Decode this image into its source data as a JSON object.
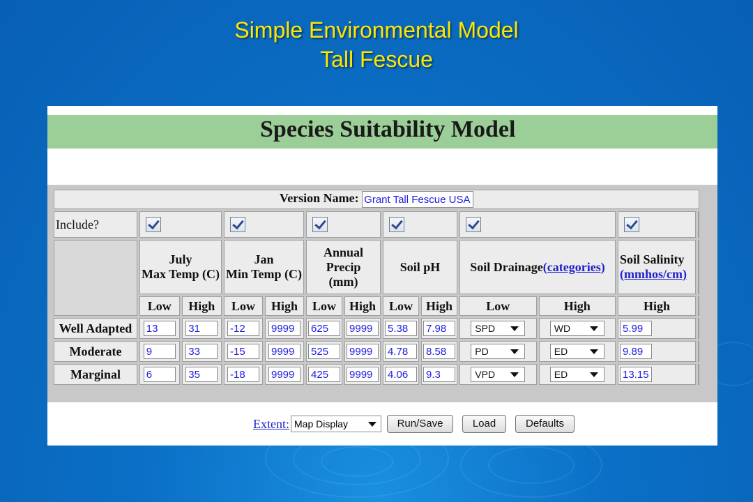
{
  "slide": {
    "title_line1": "Simple Environmental Model",
    "title_line2": "Tall Fescue"
  },
  "app": {
    "banner_title": "Species Suitability Model",
    "version_label": "Version Name:",
    "version_value": "Grant Tall Fescue USA",
    "include_label": "Include?",
    "columns": {
      "july_max": [
        "July",
        "Max Temp (C)"
      ],
      "jan_min": [
        "Jan",
        "Min Temp (C)"
      ],
      "precip": [
        "Annual",
        "Precip",
        "(mm)"
      ],
      "soil_ph": "Soil pH",
      "drainage": "Soil Drainage",
      "drainage_link": "(categories)",
      "salinity": "Soil Salinity",
      "salinity_link": "(mmhos/cm)"
    },
    "subheaders": {
      "low": "Low",
      "high": "High"
    },
    "rows": [
      {
        "label": "Well Adapted",
        "values": [
          "13",
          "31",
          "-12",
          "9999",
          "625",
          "9999",
          "5.38",
          "7.98"
        ],
        "drain_low": "SPD",
        "drain_high": "WD",
        "salinity": "5.99"
      },
      {
        "label": "Moderate",
        "values": [
          "9",
          "33",
          "-15",
          "9999",
          "525",
          "9999",
          "4.78",
          "8.58"
        ],
        "drain_low": "PD",
        "drain_high": "ED",
        "salinity": "9.89"
      },
      {
        "label": "Marginal",
        "values": [
          "6",
          "35",
          "-18",
          "9999",
          "425",
          "9999",
          "4.06",
          "9.3"
        ],
        "drain_low": "VPD",
        "drain_high": "ED",
        "salinity": "13.15"
      }
    ],
    "bottom": {
      "extent_label": "Extent:",
      "extent_value": "Map Display",
      "run_save": "Run/Save",
      "load": "Load",
      "defaults": "Defaults"
    }
  }
}
